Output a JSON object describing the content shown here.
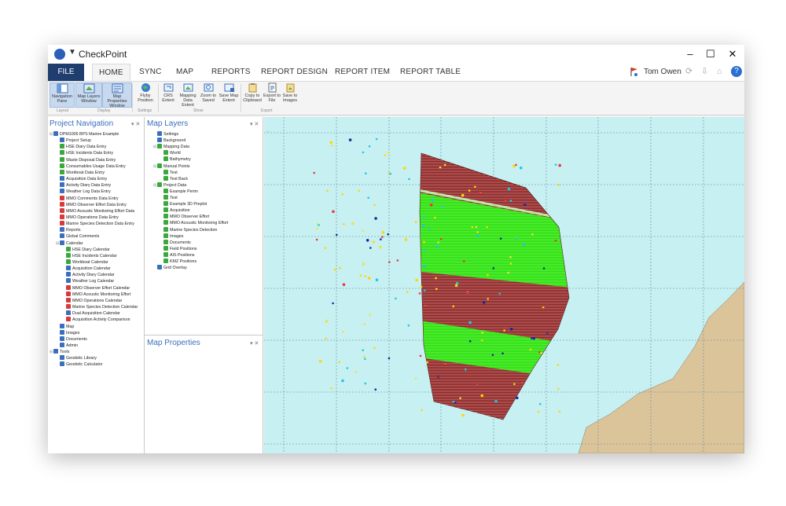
{
  "window": {
    "title": "CheckPoint",
    "qat_icon": "dropdown-arrow-icon",
    "controls": [
      "–",
      "☐",
      "✕"
    ]
  },
  "ribbon": {
    "file_label": "FILE",
    "tabs": [
      "HOME",
      "SYNC",
      "MAP",
      "REPORTS",
      "REPORT DESIGN",
      "REPORT ITEM",
      "REPORT TABLE"
    ],
    "active_tab": "HOME",
    "user": "Tom Owen",
    "buttons": [
      {
        "label": "Navigation Pane",
        "icon": "navigation-pane-icon"
      },
      {
        "label": "Map Layers Window",
        "icon": "map-layers-icon"
      },
      {
        "label": "Map Properties Window",
        "icon": "map-properties-icon"
      },
      {
        "label": "Flyby Position",
        "icon": "globe-icon"
      },
      {
        "label": "CRS Extent",
        "icon": "crs-extent-icon"
      },
      {
        "label": "Mapping Data Extent",
        "icon": "mapping-extent-icon"
      },
      {
        "label": "Zoom to Saved",
        "icon": "zoom-saved-icon"
      },
      {
        "label": "Save Map Extent",
        "icon": "save-extent-icon"
      },
      {
        "label": "Copy to Clipboard",
        "icon": "clipboard-icon"
      },
      {
        "label": "Export to File",
        "icon": "export-file-icon"
      },
      {
        "label": "Save to Images",
        "icon": "save-images-icon"
      }
    ],
    "groups": [
      "Layout",
      "Display",
      "Settings",
      "Show",
      "Export"
    ]
  },
  "nav_pane": {
    "title": "Project Navigation",
    "controls": "▾ ✕",
    "items": [
      {
        "label": "DPM1005 BPS Marine Example",
        "level": 0,
        "color": "#3a6fbd"
      },
      {
        "label": "Project Setup",
        "level": 1,
        "color": "#3a6fbd"
      },
      {
        "label": "HSE Diary Data Entry",
        "level": 1,
        "color": "#3aa83a"
      },
      {
        "label": "HSE Incidents Data Entry",
        "level": 1,
        "color": "#3aa83a"
      },
      {
        "label": "Waste Disposal Data Entry",
        "level": 1,
        "color": "#3aa83a"
      },
      {
        "label": "Consumables Usage Data Entry",
        "level": 1,
        "color": "#3aa83a"
      },
      {
        "label": "Workboat Data Entry",
        "level": 1,
        "color": "#3aa83a"
      },
      {
        "label": "Acquisition Data Entry",
        "level": 1,
        "color": "#3a6fbd"
      },
      {
        "label": "Activity Diary Data Entry",
        "level": 1,
        "color": "#3a6fbd"
      },
      {
        "label": "Weather Log Data Entry",
        "level": 1,
        "color": "#3a6fbd"
      },
      {
        "label": "MMO Comments Data Entry",
        "level": 1,
        "color": "#d83a3a"
      },
      {
        "label": "MMO Observer Effort Data Entry",
        "level": 1,
        "color": "#d83a3a"
      },
      {
        "label": "MMO Acoustic Monitoring Effort Data",
        "level": 1,
        "color": "#d83a3a"
      },
      {
        "label": "MMO Operations Data Entry",
        "level": 1,
        "color": "#d83a3a"
      },
      {
        "label": "Marine Species Detection Data Entry",
        "level": 1,
        "color": "#d83a3a"
      },
      {
        "label": "Reports",
        "level": 1,
        "color": "#3a6fbd"
      },
      {
        "label": "Global Comments",
        "level": 1,
        "color": "#3a6fbd"
      },
      {
        "label": "Calendar",
        "level": 1,
        "color": "#3a6fbd"
      },
      {
        "label": "HSE Diary Calendar",
        "level": 2,
        "color": "#3aa83a"
      },
      {
        "label": "HSE Incidents Calendar",
        "level": 2,
        "color": "#3aa83a"
      },
      {
        "label": "Workboat Calendar",
        "level": 2,
        "color": "#3aa83a"
      },
      {
        "label": "Acquisition Calendar",
        "level": 2,
        "color": "#3a6fbd"
      },
      {
        "label": "Activity Diary Calendar",
        "level": 2,
        "color": "#3a6fbd"
      },
      {
        "label": "Weather Log Calendar",
        "level": 2,
        "color": "#3a6fbd"
      },
      {
        "label": "MMO Observer Effort Calendar",
        "level": 2,
        "color": "#d83a3a"
      },
      {
        "label": "MMO Acoustic Monitoring Effort",
        "level": 2,
        "color": "#d83a3a"
      },
      {
        "label": "MMO Operations Calendar",
        "level": 2,
        "color": "#d83a3a"
      },
      {
        "label": "Marine Species Detection Calendar",
        "level": 2,
        "color": "#d83a3a"
      },
      {
        "label": "Dual Acquisition Calendar",
        "level": 2,
        "color": "#3a6fbd"
      },
      {
        "label": "Acquisition Activity Comparison",
        "level": 2,
        "color": "#d83a3a"
      },
      {
        "label": "Map",
        "level": 1,
        "color": "#3a6fbd"
      },
      {
        "label": "Images",
        "level": 1,
        "color": "#3a6fbd"
      },
      {
        "label": "Documents",
        "level": 1,
        "color": "#3a6fbd"
      },
      {
        "label": "Admin",
        "level": 1,
        "color": "#3a6fbd"
      },
      {
        "label": "Tools",
        "level": 0,
        "color": "#3a6fbd"
      },
      {
        "label": "Geodetic Library",
        "level": 1,
        "color": "#3a6fbd"
      },
      {
        "label": "Geodetic Calculator",
        "level": 1,
        "color": "#3a6fbd"
      }
    ]
  },
  "layers_pane": {
    "title": "Map Layers",
    "controls": "▾ ✕",
    "items": [
      {
        "label": "Settings",
        "level": 1,
        "color": "#3a6fbd"
      },
      {
        "label": "Background",
        "level": 1,
        "color": "#3a6fbd"
      },
      {
        "label": "Mapping Data",
        "level": 1,
        "color": "#3aa83a"
      },
      {
        "label": "World",
        "level": 2,
        "color": "#3aa83a"
      },
      {
        "label": "Bathymetry",
        "level": 2,
        "color": "#3aa83a"
      },
      {
        "label": "Manual Points",
        "level": 1,
        "color": "#3aa83a"
      },
      {
        "label": "Test",
        "level": 2,
        "color": "#3aa83a"
      },
      {
        "label": "Test Back",
        "level": 2,
        "color": "#3aa83a"
      },
      {
        "label": "Project Data",
        "level": 1,
        "color": "#3aa83a"
      },
      {
        "label": "Example Perim",
        "level": 2,
        "color": "#3aa83a"
      },
      {
        "label": "Test",
        "level": 2,
        "color": "#3aa83a"
      },
      {
        "label": "Example 3D Preplot",
        "level": 2,
        "color": "#3aa83a"
      },
      {
        "label": "Acquisition",
        "level": 2,
        "color": "#3aa83a"
      },
      {
        "label": "MMO Observer Effort",
        "level": 2,
        "color": "#3aa83a"
      },
      {
        "label": "MMO Acoustic Monitoring Effort",
        "level": 2,
        "color": "#3aa83a"
      },
      {
        "label": "Marine Species Detection",
        "level": 2,
        "color": "#3aa83a"
      },
      {
        "label": "Images",
        "level": 2,
        "color": "#3aa83a"
      },
      {
        "label": "Documents",
        "level": 2,
        "color": "#3aa83a"
      },
      {
        "label": "Field Positions",
        "level": 2,
        "color": "#3aa83a"
      },
      {
        "label": "AIS Positions",
        "level": 2,
        "color": "#3aa83a"
      },
      {
        "label": "KMZ Positions",
        "level": 2,
        "color": "#3aa83a"
      },
      {
        "label": "Grid Overlay",
        "level": 1,
        "color": "#3a6fbd"
      }
    ]
  },
  "props_pane": {
    "title": "Map Properties",
    "controls": "▾ ✕"
  },
  "map": {
    "colors": {
      "sea": "#c7f0f2",
      "land": "#dcc49a",
      "acquired": "#8b1e1e",
      "planned": "#22e000",
      "grid": "#5a8aa0"
    }
  }
}
